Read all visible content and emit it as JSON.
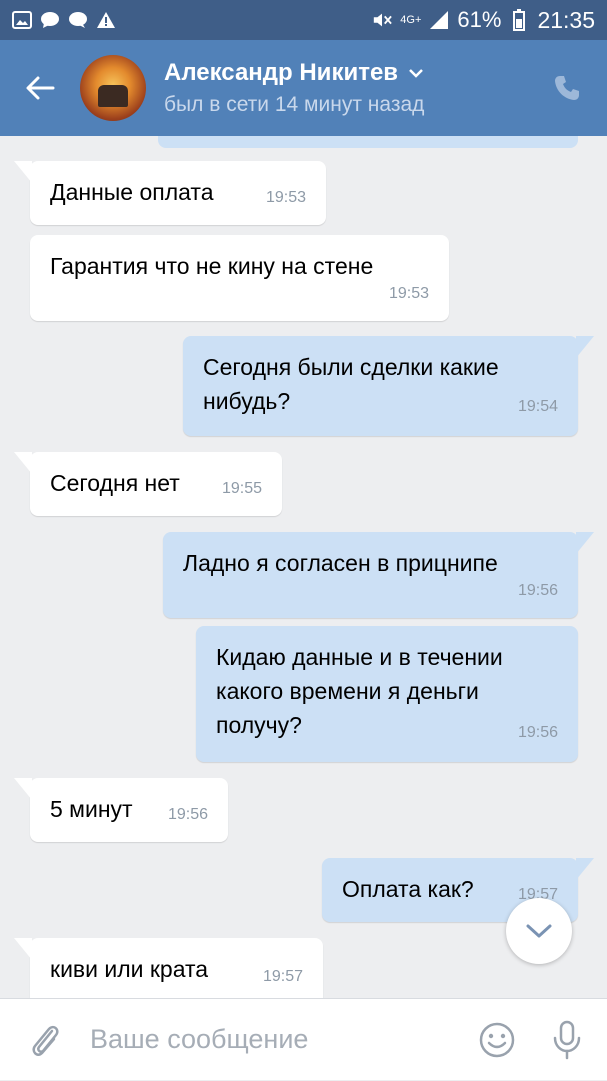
{
  "status_bar": {
    "network": "4G+",
    "battery_pct": "61%",
    "time": "21:35",
    "icons": [
      "gallery-icon",
      "message-icon",
      "chat-icon",
      "warning-icon",
      "mute-icon",
      "signal-icon",
      "battery-icon"
    ]
  },
  "header": {
    "contact_name": "Александр Никитев",
    "contact_status": "был в сети 14 минут назад"
  },
  "messages": [
    {
      "dir": "in",
      "text": "Данные оплата",
      "time": "19:53"
    },
    {
      "dir": "in",
      "text": "Гарантия что не кину на стене",
      "time": "19:53"
    },
    {
      "dir": "out",
      "text": "Сегодня были сделки какие нибудь?",
      "time": "19:54"
    },
    {
      "dir": "in",
      "text": "Сегодня нет",
      "time": "19:55"
    },
    {
      "dir": "out",
      "text": "Ладно я согласен в прицнипе",
      "time": "19:56"
    },
    {
      "dir": "out",
      "text": "Кидаю данные и в течении какого времени я деньги получу?",
      "time": "19:56"
    },
    {
      "dir": "in",
      "text": "5 минут",
      "time": "19:56"
    },
    {
      "dir": "out",
      "text": "Оплата как?",
      "time": "19:57"
    },
    {
      "dir": "in",
      "text": "киви или крата",
      "time": "19:57"
    }
  ],
  "composer": {
    "placeholder": "Ваше сообщение"
  },
  "colors": {
    "header_bg": "#5181b8",
    "status_bar_bg": "#3f5e88",
    "chat_bg": "#edeef0",
    "incoming_bubble": "#ffffff",
    "outgoing_bubble": "#cce0f5"
  }
}
